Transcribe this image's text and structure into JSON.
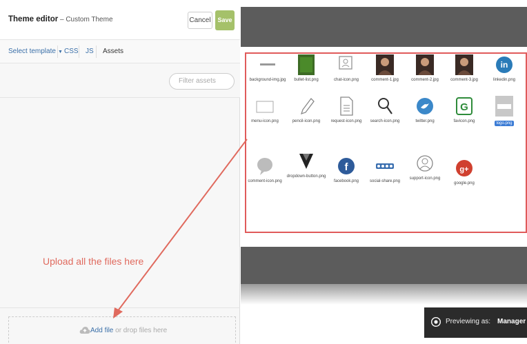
{
  "editor": {
    "title": "Theme editor",
    "subtitle": " – Custom Theme",
    "cancel_label": "Cancel",
    "save_label": "Save",
    "tabs": {
      "select_template": "Select template",
      "css": "CSS",
      "js": "JS",
      "assets": "Assets"
    },
    "filter_placeholder": "Filter assets",
    "annotation": "Upload all the files here",
    "add_file": "Add file",
    "drop_files": " or drop files here"
  },
  "preview": {
    "badge_label": "Previewing as:",
    "badge_role": "Manager",
    "assets": [
      {
        "label": "background-img.jpg",
        "icon": "line-icon"
      },
      {
        "label": "bullet-list.png",
        "icon": "green-square-icon"
      },
      {
        "label": "chat-icon.png",
        "icon": "chat-icon"
      },
      {
        "label": "comment-1.jpg",
        "icon": "portrait-icon"
      },
      {
        "label": "comment-2.jpg",
        "icon": "portrait-icon"
      },
      {
        "label": "comment-3.jpg",
        "icon": "portrait-icon"
      },
      {
        "label": "linkedin.png",
        "icon": "linkedin-icon"
      },
      {
        "label": "menu-icon.png",
        "icon": "box-icon"
      },
      {
        "label": "pencil-icon.png",
        "icon": "pencil-icon"
      },
      {
        "label": "request-icon.png",
        "icon": "document-icon"
      },
      {
        "label": "search-icon.png",
        "icon": "search-icon"
      },
      {
        "label": "twitter.png",
        "icon": "twitter-icon"
      },
      {
        "label": "favicon.png",
        "icon": "favicon-icon"
      },
      {
        "label": "logo.png",
        "icon": "logo-icon"
      },
      {
        "label": "comment-icon.png",
        "icon": "bubble-icon"
      },
      {
        "label": "dropdown-button.png",
        "icon": "dropdown-icon"
      },
      {
        "label": "facebook.png",
        "icon": "facebook-icon"
      },
      {
        "label": "social-share.png",
        "icon": "share-icon"
      },
      {
        "label": "support-icon.png",
        "icon": "support-icon"
      },
      {
        "label": "google.png",
        "icon": "google-icon"
      }
    ]
  },
  "colors": {
    "link": "#3a6fa8",
    "save": "#a5c16a",
    "annotation": "#e06a5e",
    "selected": "#3a7bd5"
  }
}
